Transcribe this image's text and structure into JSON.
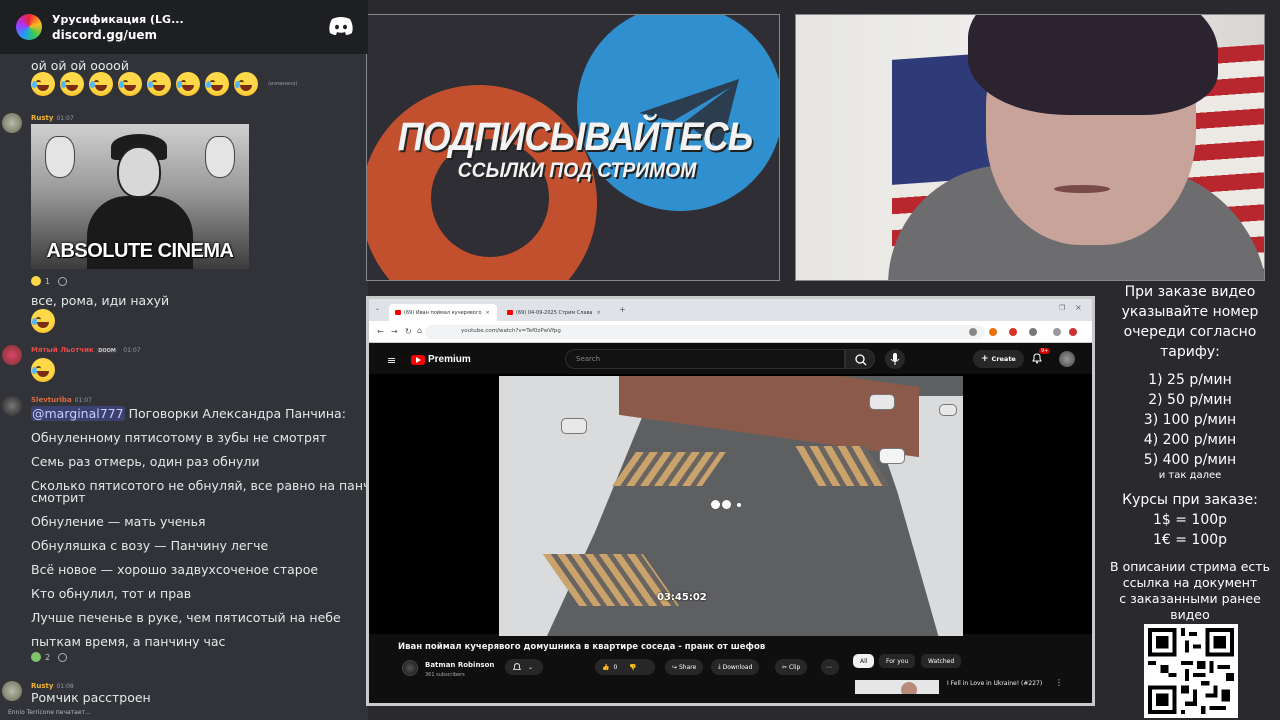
{
  "discord": {
    "server_name": "Урусификация (LG...",
    "invite": "discord.gg/uem",
    "messages": [
      {
        "text": "ой ой ой оооой"
      },
      {
        "reaction_note": "(изменено)"
      },
      {
        "username": "Rusty",
        "time": "01:07",
        "image_caption": "ABSOLUTE CINEMA",
        "reaction_count": "1"
      },
      {
        "text": "все, рома, иди нахуй"
      },
      {
        "username": "Мятый Льотчик",
        "badge": "DOOM",
        "time": "01:07"
      },
      {
        "username": "Slevturiba",
        "time": "01:07"
      },
      {
        "mention": "@marginal777",
        "text": "Поговорки Александра Панчина:"
      },
      {
        "text": "Обнуленному пятисотому в зубы не смотрят"
      },
      {
        "text": "Семь раз отмерь, один раз обнули"
      },
      {
        "text": "Сколько пятисотого не обнуляй, все равно на панчина"
      },
      {
        "text": "смотрит"
      },
      {
        "text": "Обнуление — мать ученья"
      },
      {
        "text": "Обнуляшка с возу — Панчину легче"
      },
      {
        "text": "Всё новое — хорошо задвухсоченое старое"
      },
      {
        "text": "Кто обнулил, тот и прав"
      },
      {
        "text": "Лучше печенье в руке, чем пятисотый на небе"
      },
      {
        "text": "пыткам время, а панчину час"
      },
      {
        "reaction_count": "2"
      },
      {
        "username": "Rusty",
        "time": "01:08"
      },
      {
        "text": "Ромчик расстроен"
      }
    ],
    "typing": "Ennio Terricone печатает..."
  },
  "banner": {
    "title": "ПОДПИСЫВАЙТЕСЬ",
    "subtitle": "ССЫЛКИ ПОД СТРИМОМ"
  },
  "browser": {
    "tabs": [
      {
        "label": "(69) Иван поймал кучерявого"
      },
      {
        "label": "(69) 04-09-2025 Стрим Слава"
      }
    ],
    "url": "youtube.com/watch?v=Tef0zPwVfpg"
  },
  "youtube": {
    "brand": "Premium",
    "search_placeholder": "Search",
    "create_label": "Create",
    "notif_badge": "9+",
    "timestamp": "03:45:02",
    "video_title": "Иван поймал кучерявого домушника в квартире соседа - пранк от шефов",
    "channel": "Batman Robinson",
    "subscribers": "361 subscribers",
    "likes": "0",
    "share_label": "Share",
    "download_label": "Download",
    "clip_label": "Clip",
    "chips": [
      "All",
      "For you",
      "Watched"
    ],
    "recommended_title": "I Fell in Love in Ukraine! (#227)"
  },
  "pricelist": {
    "intro": [
      "При заказе видео",
      "указывайте номер",
      "очереди согласно",
      "тарифу:"
    ],
    "tariffs": [
      "1) 25 р/мин",
      "2) 50 р/мин",
      "3) 100 р/мин",
      "4) 200 р/мин",
      "5) 400 р/мин"
    ],
    "etc": "и так далее",
    "rates_title": "Курсы при заказе:",
    "rates": [
      "1$ = 100р",
      "1€ = 100р"
    ],
    "note": [
      "В описании стрима есть",
      "ссылка на документ",
      "с заказанными ранее",
      "видео"
    ]
  },
  "colors": {
    "discord_bg": "#313338",
    "accent_red": "#ff0000",
    "telegram_blue": "#2f8fcf",
    "patreon_red": "#c2502f"
  }
}
